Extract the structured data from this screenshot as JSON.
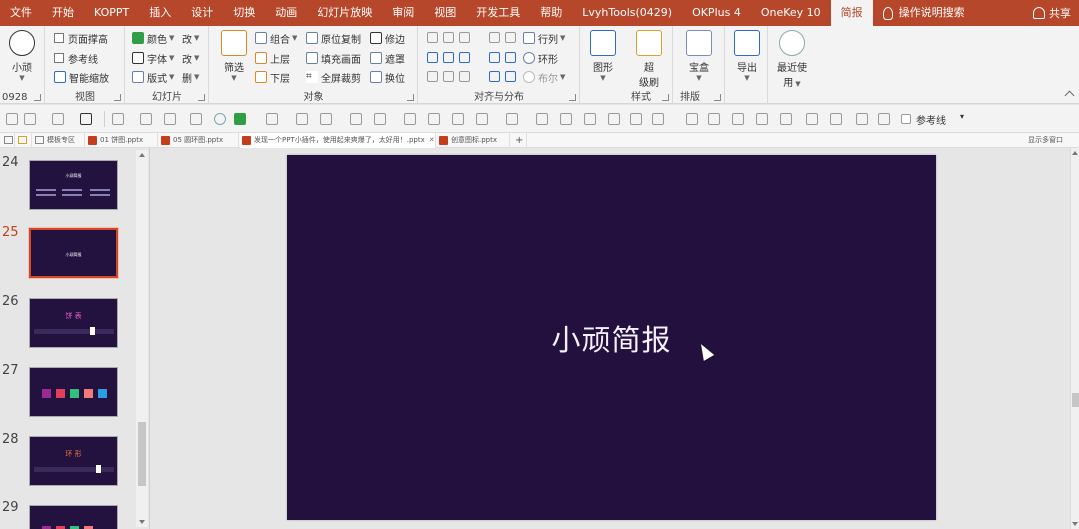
{
  "menu": {
    "items": [
      "文件",
      "开始",
      "KOPPT",
      "插入",
      "设计",
      "切换",
      "动画",
      "幻灯片放映",
      "审阅",
      "视图",
      "开发工具",
      "帮助",
      "LvyhTools(0429)",
      "OKPlus 4",
      "OneKey 10",
      "简报"
    ],
    "active": "简报",
    "search_label": "操作说明搜索",
    "share_label": "共享"
  },
  "ribbon": {
    "g1": {
      "big_label": "小顽",
      "version": "0928"
    },
    "g2": {
      "chk_page_height": "页面撑高",
      "chk_guides": "参考线",
      "smart_zoom": "智能缩放",
      "label": "视图"
    },
    "g3": {
      "color": "颜色",
      "font": "字体",
      "layout": "版式",
      "change1": "改",
      "change2": "改",
      "delete": "删",
      "label": "幻灯片"
    },
    "g4": {
      "filter": "筛选",
      "group": "组合",
      "bring_up": "上层",
      "send_down": "下层",
      "copy_in_place": "原位复制",
      "fill_canvas": "填充画面",
      "fullscreen_crop": "全屏裁剪",
      "trim_edge": "修边",
      "mask": "遮罩",
      "swap": "换位",
      "label": "对象"
    },
    "g5": {
      "row_col": "行列",
      "ring": "环形",
      "boolean": "布尔",
      "label": "对齐与分布"
    },
    "g6": {
      "shape": "图形",
      "format_painter_1": "超",
      "format_painter_2": "级刷",
      "label": "样式"
    },
    "g7": {
      "treasure": "宝盒",
      "label": "排版"
    },
    "g8": {
      "export": "导出"
    },
    "g9": {
      "recent_1": "最近使",
      "recent_2": "用"
    }
  },
  "quickbar": {
    "guides_label": "参考线"
  },
  "doctabs": [
    {
      "label": "模板专区",
      "kind": "home",
      "active": false
    },
    {
      "label": "01 饼图.pptx",
      "kind": "ppt",
      "active": false
    },
    {
      "label": "05 圆环图.pptx",
      "kind": "ppt",
      "active": false
    },
    {
      "label": "发现一个PPT小插件，使用起来爽爆了，太好用！.pptx",
      "kind": "ppt",
      "active": true
    },
    {
      "label": "创意图标.pptx",
      "kind": "ppt",
      "active": false
    }
  ],
  "doctabs_right": "显示多窗口",
  "thumbnails": [
    {
      "num": "24",
      "title": "小顽简报",
      "current": false
    },
    {
      "num": "25",
      "title": "小顽简报",
      "current": true
    },
    {
      "num": "26",
      "title": "饼 表",
      "current": false
    },
    {
      "num": "27",
      "title": "",
      "current": false
    },
    {
      "num": "28",
      "title": "环 形",
      "current": false
    },
    {
      "num": "29",
      "title": "",
      "current": false
    }
  ],
  "slide": {
    "title": "小顽简报",
    "background": "#24103f"
  },
  "colors": {
    "accent": "#b7472a",
    "selection": "#d24726",
    "swatches": [
      "#9b2a8e",
      "#e0405a",
      "#33c07a",
      "#f07a78",
      "#2a9fe0"
    ]
  }
}
